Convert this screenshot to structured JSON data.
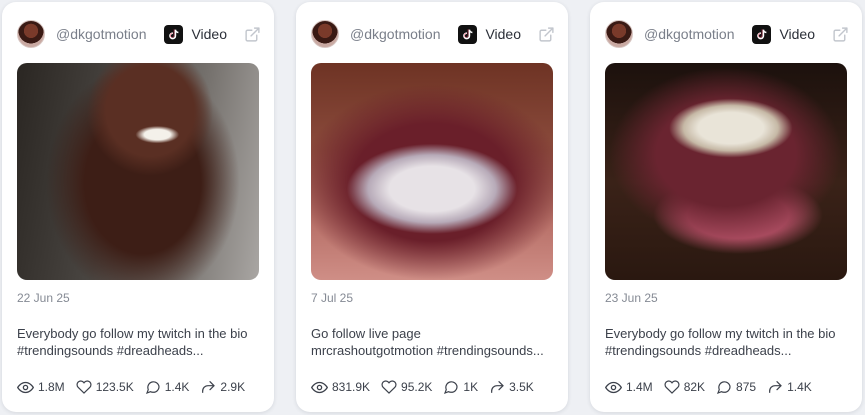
{
  "cards": [
    {
      "handle": "@dkgotmotion",
      "platform": "Video",
      "date": "22 Jun 25",
      "caption_line1": "Everybody go follow my twitch in the bio",
      "caption_line2": "#trendingsounds #dreadheads...",
      "views": "1.8M",
      "likes": "123.5K",
      "comments": "1.4K",
      "shares": "2.9K"
    },
    {
      "handle": "@dkgotmotion",
      "platform": "Video",
      "date": "7 Jul 25",
      "caption_line1": "Go follow live page",
      "caption_line2": "mrcrashoutgotmotion #trendingsounds...",
      "views": "831.9K",
      "likes": "95.2K",
      "comments": "1K",
      "shares": "3.5K"
    },
    {
      "handle": "@dkgotmotion",
      "platform": "Video",
      "date": "23 Jun 25",
      "caption_line1": "Everybody go follow my twitch in the bio",
      "caption_line2": "#trendingsounds #dreadheads...",
      "views": "1.4M",
      "likes": "82K",
      "comments": "875",
      "shares": "1.4K"
    }
  ],
  "icons": {
    "platform": "tiktok-icon",
    "link": "external-link-icon",
    "views": "eye-icon",
    "likes": "heart-icon",
    "comments": "comment-icon",
    "shares": "share-icon"
  },
  "colors": {
    "card_bg": "#ffffff",
    "page_bg": "#eef0f4",
    "muted_text": "#7a7f8a",
    "body_text": "#3c414b"
  }
}
